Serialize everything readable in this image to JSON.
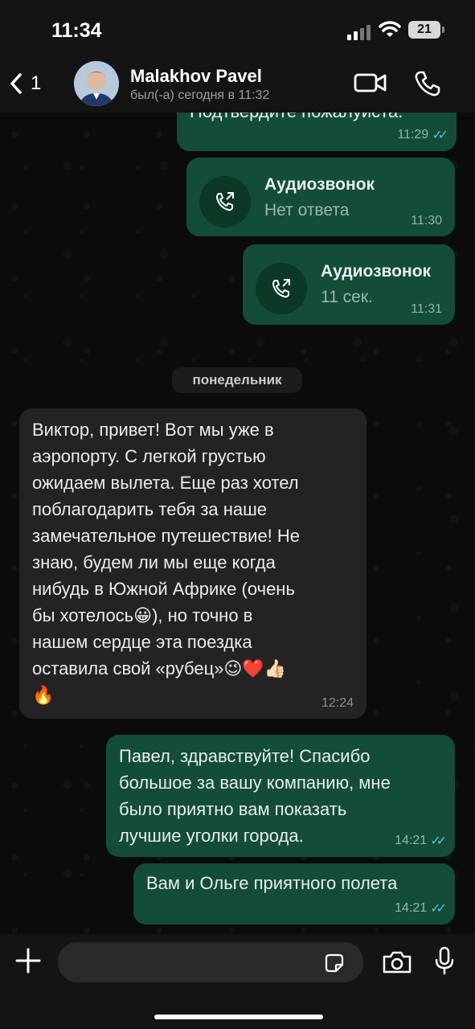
{
  "status_bar": {
    "time": "11:34",
    "battery": "21"
  },
  "header": {
    "back_count": "1",
    "contact_name": "Malakhov Pavel",
    "contact_status": "был(-а) сегодня в 11:32"
  },
  "messages": [
    {
      "text": "Подтвердите пожалуйста.",
      "time": "11:29"
    },
    {
      "title": "Аудиозвонок",
      "subtitle": "Нет ответа",
      "time": "11:30"
    },
    {
      "title": "Аудиозвонок",
      "subtitle": "11 сек.",
      "time": "11:31"
    },
    {
      "text": "Виктор, привет! Вот мы уже в\nаэропорту. С легкой грустью\nожидаем вылета. Еще раз хотел\nпоблагодарить тебя за наше\nзамечательное путешествие! Не\nзнаю, будем ли мы еще когда\nнибудь в Южной Африке (очень\nбы хотелось😀), но точно в\nнашем сердце эта поездка\nоставила свой «рубец»😉❤️👍🏻\n🔥",
      "time": "12:24"
    },
    {
      "text": "Павел, здравствуйте! Спасибо\nбольшое за вашу компанию, мне\nбыло приятно вам показать\nлучшие уголки города.",
      "time": "14:21"
    },
    {
      "text": "Вам и Ольге приятного полета",
      "time": "14:21"
    }
  ],
  "date_separator": "понедельник",
  "composer": {
    "placeholder": ""
  },
  "colors": {
    "outgoing_bubble": "#134d37",
    "incoming_bubble": "#232323",
    "read_ticks": "#53bdeb"
  }
}
